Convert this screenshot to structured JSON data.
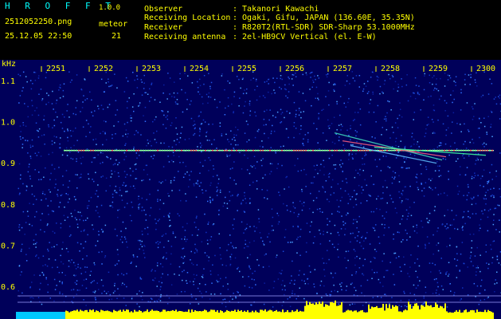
{
  "app": {
    "name": "H R O F F T",
    "version": "1.0.0",
    "filename": "2512052250.png",
    "datetime": "25.12.05 22:50",
    "meteor_label": "meteor",
    "meteor_count": "21"
  },
  "info": [
    {
      "label": "Observer",
      "value": ": Takanori Kawachi"
    },
    {
      "label": "Receiving Location",
      "value": ": Ogaki, Gifu, JAPAN (136.60E, 35.35N)"
    },
    {
      "label": "Receiver",
      "value": ": R820T2(RTL-SDR) SDR-Sharp 53.1000MHz"
    },
    {
      "label": "Receiving antenna",
      "value": ": 2el-HB9CV Vertical (el. E-W)"
    }
  ],
  "axis": {
    "unit": "kHz",
    "time_ticks": [
      "2251",
      "2252",
      "2253",
      "2254",
      "2255",
      "2256",
      "2257",
      "2258",
      "2259",
      "2300"
    ],
    "freq_ticks": [
      "1.1",
      "1.0",
      "0.9",
      "0.8",
      "0.7",
      "0.6"
    ]
  },
  "colors": {
    "header_text": "#ffff00",
    "title_text": "#00ffff",
    "background": "#000080",
    "noise_bar": "#ffff00",
    "carrier": "#ff4040"
  },
  "chart_data": {
    "type": "heatmap",
    "x_tick_labels": [
      "2251",
      "2252",
      "2253",
      "2254",
      "2255",
      "2256",
      "2257",
      "2258",
      "2259",
      "2300"
    ],
    "y_tick_labels": [
      "1.1",
      "1.0",
      "0.9",
      "0.8",
      "0.7",
      "0.6"
    ],
    "ylabel": "kHz",
    "ylim": [
      0.55,
      1.15
    ],
    "carrier_frequency": 0.93,
    "carrier_x_range": [
      "2252",
      "2300"
    ],
    "meteor_count": 21
  }
}
